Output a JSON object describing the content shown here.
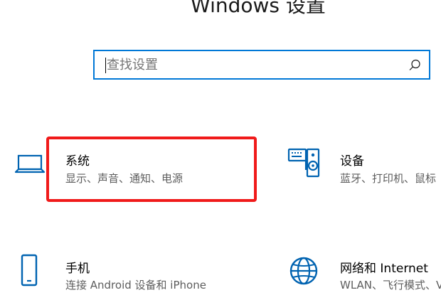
{
  "window": {
    "title": "Windows 设置"
  },
  "search": {
    "placeholder": "查找设置",
    "icon": "search-icon"
  },
  "tiles": [
    {
      "id": "system",
      "title": "系统",
      "desc": "显示、声音、通知、电源",
      "icon": "laptop-icon"
    },
    {
      "id": "devices",
      "title": "设备",
      "desc": "蓝牙、打印机、鼠标",
      "icon": "devices-icon"
    },
    {
      "id": "phone",
      "title": "手机",
      "desc": "连接 Android 设备和 iPhone",
      "icon": "phone-icon"
    },
    {
      "id": "network",
      "title": "网络和 Internet",
      "desc": "WLAN、飞行模式、VPN",
      "icon": "globe-icon"
    }
  ],
  "colors": {
    "accent": "#0078d7",
    "highlight": "#f01a1a",
    "desc_text": "#5d5d5d"
  }
}
